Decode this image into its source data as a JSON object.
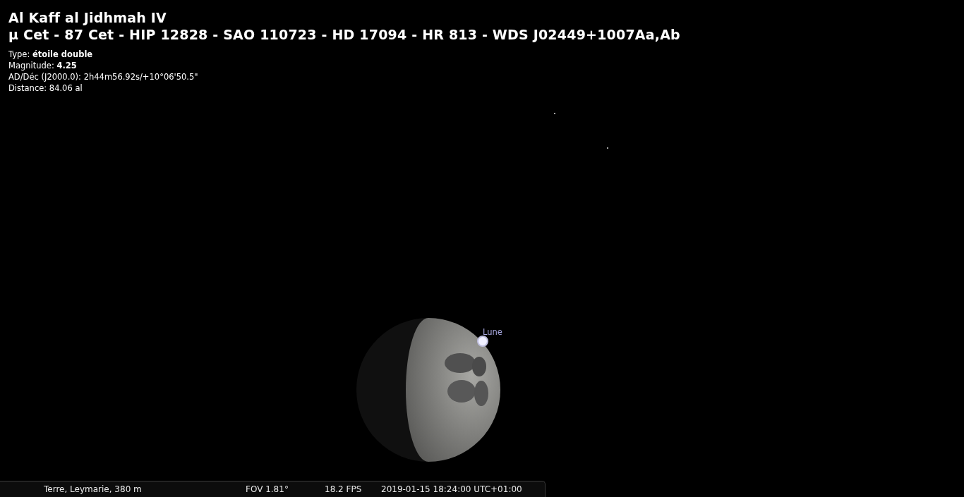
{
  "object": {
    "name": "Al Kaff al Jidhmah IV",
    "designations": "μ Cet - 87 Cet - HIP 12828 - SAO 110723 - HD 17094 - HR 813 - WDS J02449+1007Aa,Ab",
    "info": [
      "Type: **étoile double**",
      "Magnitude: **4.25**",
      "AD/Déc (J2000.0): 2h44m56.92s/+10°06'50.5\"",
      "Distance: 84.06 al"
    ]
  },
  "sky": {
    "moon_label": "Lune"
  },
  "status_bar": {
    "location": "Terre, Leymarie, 380 m",
    "fov": "FOV 1.81°",
    "fps": "18.2 FPS",
    "datetime": "2019-01-15 18:24:00 UTC+01:00"
  }
}
